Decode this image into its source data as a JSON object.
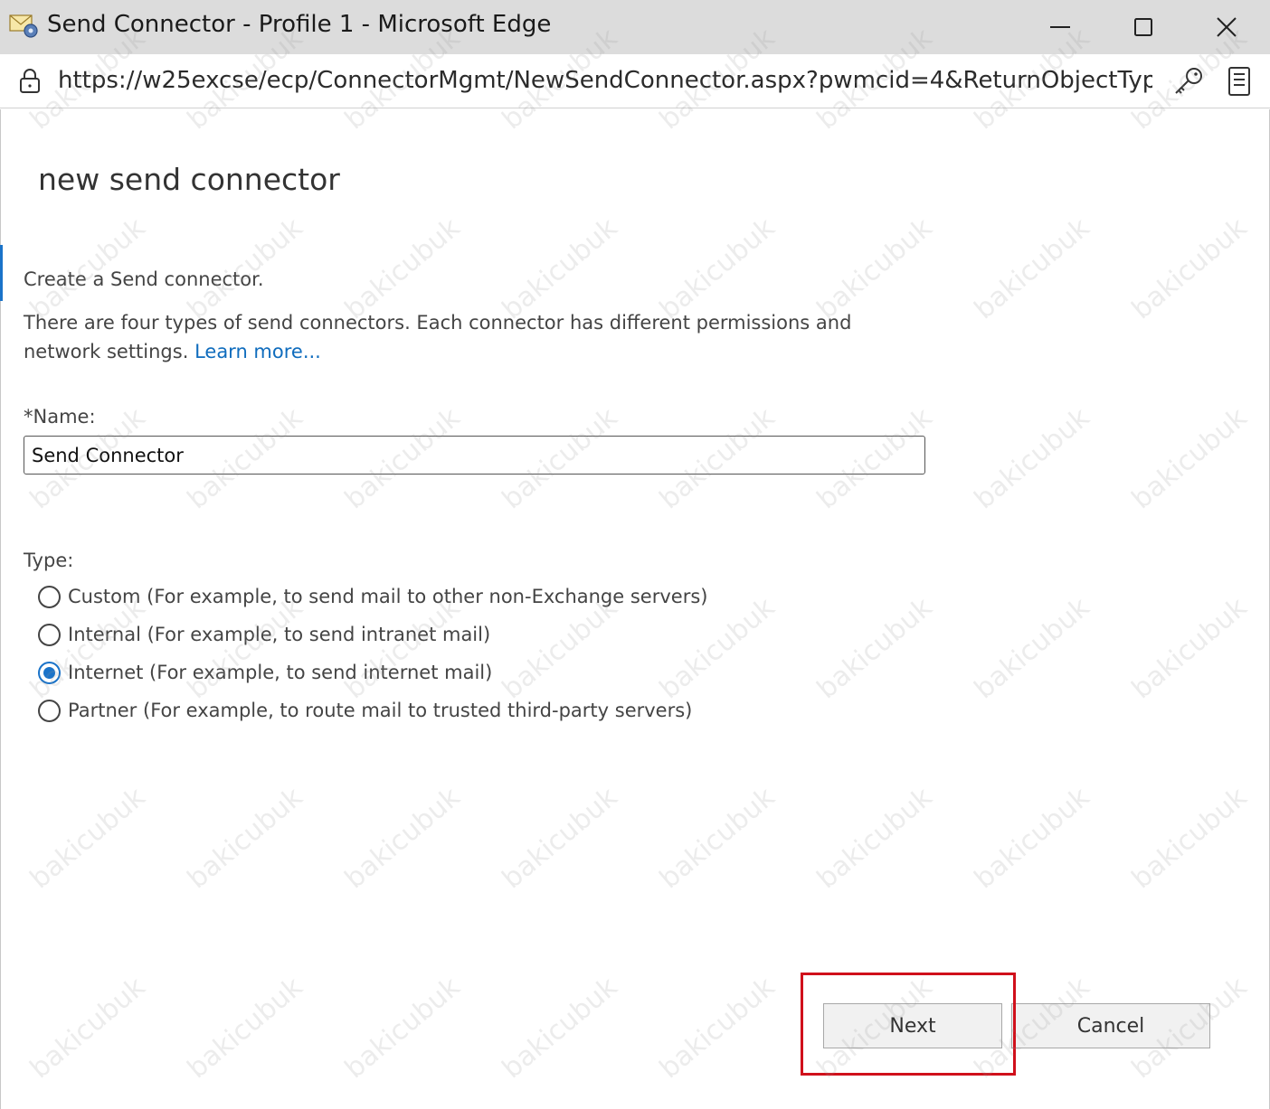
{
  "window": {
    "title": "Send Connector - Profile 1 - Microsoft Edge",
    "icon": "mail-settings-icon",
    "controls": [
      "minimize-icon",
      "maximize-icon",
      "close-icon"
    ]
  },
  "address_bar": {
    "url": "https://w25excse/ecp/ConnectorMgmt/NewSendConnector.aspx?pwmcid=4&ReturnObjectType...",
    "icons": [
      "lock-icon",
      "key-icon",
      "reader-view-icon"
    ]
  },
  "page": {
    "title": "new send connector",
    "intro": "Create a Send connector.",
    "description": "There are four types of send connectors. Each connector has different permissions and network settings. ",
    "learn_more": "Learn more..."
  },
  "form": {
    "name_label": "*Name:",
    "name_value": "Send Connector",
    "type_label": "Type:",
    "types": [
      {
        "label": "Custom (For example, to send mail to other non-Exchange servers)",
        "checked": false
      },
      {
        "label": "Internal (For example, to send intranet mail)",
        "checked": false
      },
      {
        "label": "Internet (For example, to send internet mail)",
        "checked": true
      },
      {
        "label": "Partner (For example, to route mail to trusted third-party servers)",
        "checked": false
      }
    ]
  },
  "buttons": {
    "next": "Next",
    "cancel": "Cancel"
  },
  "colors": {
    "accent": "#1a73c9",
    "link": "#0f6cbd",
    "highlight": "#d0101b",
    "titlebar": "#dcdcdc"
  },
  "watermark": "bakicubuk"
}
